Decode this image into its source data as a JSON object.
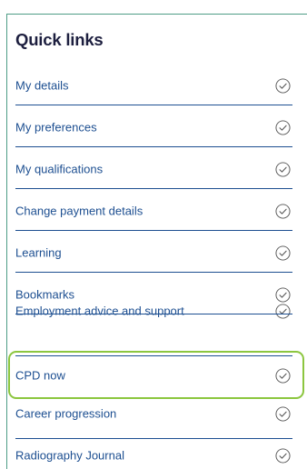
{
  "quick_links": {
    "title": "Quick links",
    "items": [
      {
        "label": "My details",
        "icon": "check-circle-icon"
      },
      {
        "label": "My preferences",
        "icon": "check-circle-icon"
      },
      {
        "label": "My qualifications",
        "icon": "check-circle-icon"
      },
      {
        "label": "Change payment details",
        "icon": "check-circle-icon"
      },
      {
        "label": "Learning",
        "icon": "check-circle-icon"
      },
      {
        "label": "Bookmarks",
        "icon": "check-circle-icon"
      },
      {
        "label": "Employment advice and support",
        "icon": "check-circle-icon"
      },
      {
        "label": "CPD now",
        "icon": "check-circle-icon",
        "highlighted": true
      },
      {
        "label": "Career progression",
        "icon": "check-circle-icon"
      },
      {
        "label": "Radiography Journal",
        "icon": "check-circle-icon"
      }
    ]
  },
  "colors": {
    "title": "#1d1f3f",
    "link": "#1d4f91",
    "panel_border": "#4e9c86",
    "highlight_border": "#8cc63f"
  }
}
